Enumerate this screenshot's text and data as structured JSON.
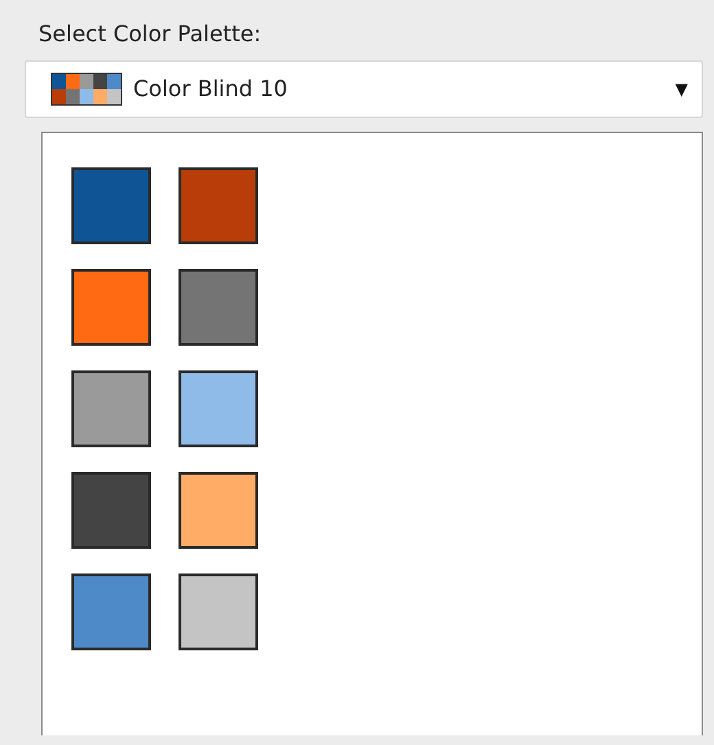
{
  "label": "Select Color Palette:",
  "dropdown": {
    "value": "Color Blind 10",
    "arrow": "▼"
  },
  "swatches": [
    {
      "color": "#0f5596"
    },
    {
      "color": "#ff6a12"
    },
    {
      "color": "#9a9a9a"
    },
    {
      "color": "#444444"
    },
    {
      "color": "#4f8ac8"
    },
    {
      "color": "#b83d08"
    },
    {
      "color": "#747474"
    },
    {
      "color": "#8ebbe8"
    },
    {
      "color": "#ffad66"
    },
    {
      "color": "#c4c4c4"
    }
  ]
}
